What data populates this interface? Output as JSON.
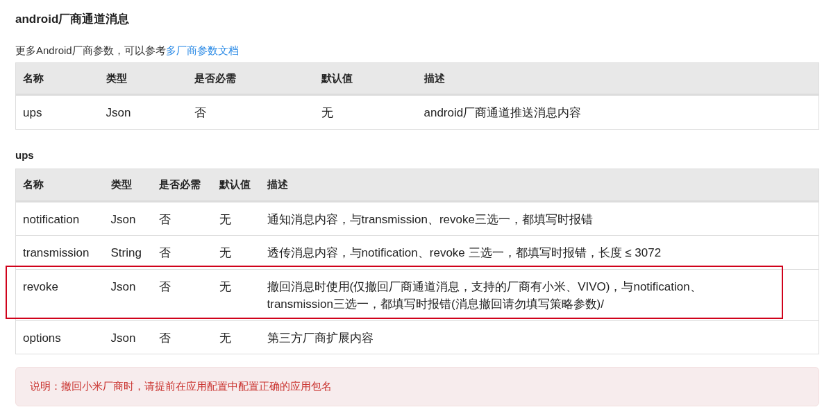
{
  "title": "android厂商通道消息",
  "intro": {
    "text": "更多Android厂商参数，可以参考",
    "link": "多厂商参数文档"
  },
  "tables": [
    {
      "columns": [
        "名称",
        "类型",
        "是否必需",
        "默认值",
        "描述"
      ],
      "rows": [
        {
          "cells": [
            "ups",
            "Json",
            "否",
            "无",
            "android厂商通道推送消息内容"
          ],
          "highlighted": false
        }
      ]
    },
    {
      "caption": "ups",
      "columns": [
        "名称",
        "类型",
        "是否必需",
        "默认值",
        "描述"
      ],
      "rows": [
        {
          "cells": [
            "notification",
            "Json",
            "否",
            "无",
            "通知消息内容，与transmission、revoke三选一，都填写时报错"
          ],
          "highlighted": false
        },
        {
          "cells": [
            "transmission",
            "String",
            "否",
            "无",
            "透传消息内容，与notification、revoke 三选一，都填写时报错，长度 ≤ 3072"
          ],
          "highlighted": false
        },
        {
          "cells": [
            "revoke",
            "Json",
            "否",
            "无",
            "撤回消息时使用(仅撤回厂商通道消息，支持的厂商有小米、VIVO)，与notification、transmission三选一，都填写时报错(消息撤回请勿填写策略参数)/"
          ],
          "highlighted": true
        },
        {
          "cells": [
            "options",
            "Json",
            "否",
            "无",
            "第三方厂商扩展内容"
          ],
          "highlighted": false
        }
      ]
    }
  ],
  "note": "说明：撤回小米厂商时，请提前在应用配置中配置正确的应用包名"
}
